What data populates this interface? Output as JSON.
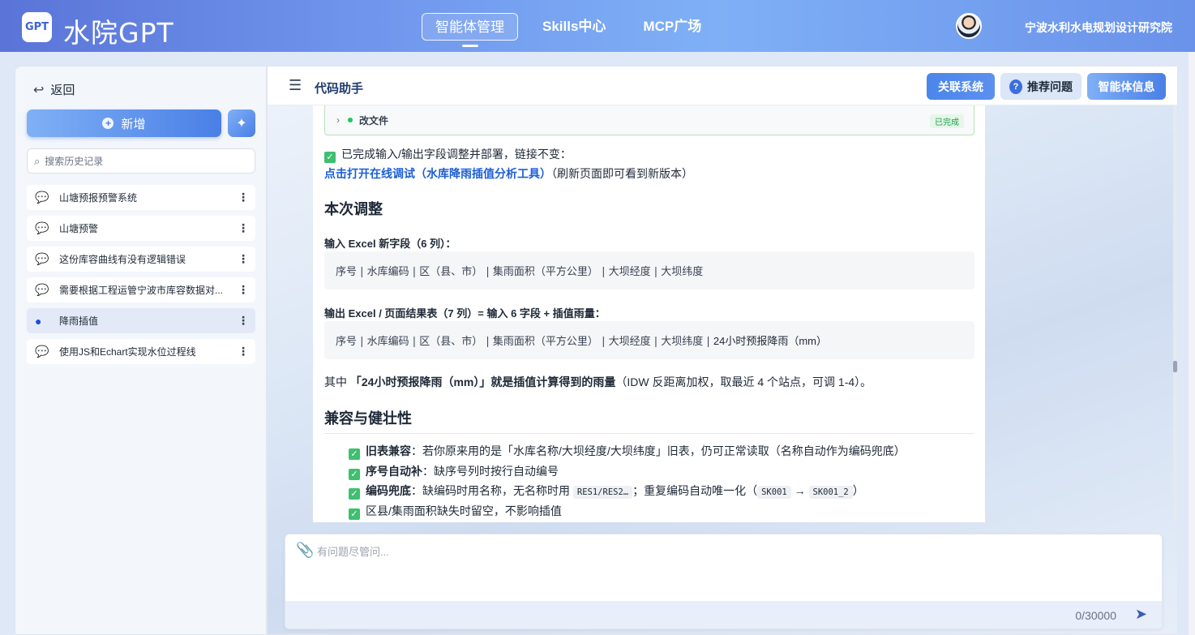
{
  "header": {
    "logo_text": "GPT",
    "app_title": "水院GPT",
    "nav": [
      "智能体管理",
      "Skills中心",
      "MCP广场"
    ],
    "org_name": "宁波水利水电规划设计研究院"
  },
  "sidebar": {
    "back_label": "返回",
    "new_label": "新增",
    "search_placeholder": "搜索历史记录",
    "history": [
      {
        "label": "山塘预报预警系统"
      },
      {
        "label": "山塘预警"
      },
      {
        "label": "这份库容曲线有没有逻辑错误"
      },
      {
        "label": "需要根据工程运管宁波市库容数据对..."
      },
      {
        "label": "降雨插值",
        "active": true
      },
      {
        "label": "使用JS和Echart实现水位过程线"
      }
    ]
  },
  "main": {
    "title": "代码助手",
    "buttons": {
      "link_system": "关联系统",
      "recommend": "推荐问题",
      "agent_info": "智能体信息"
    },
    "step": {
      "name": "改文件",
      "status": "已完成"
    },
    "done_line": "已完成输入/输出字段调整并部署，链接不变：",
    "link_text": "点击打开在线调试（水库降雨插值分析工具）",
    "link_note": "（刷新页面即可看到新版本）",
    "section1_title": "本次调整",
    "input_label": "输入 Excel 新字段（6 列）：",
    "input_fields": "序号 | 水库编码 | 区（县、市） | 集雨面积（平方公里） | 大坝经度 | 大坝纬度",
    "output_label": "输出 Excel / 页面结果表（7 列）= 输入 6 字段 + 插值雨量：",
    "output_fields_prefix": "序号 | 水库编码 | 区（县、市） | 集雨面积（平方公里） | 大坝经度 | 大坝纬度 | ",
    "output_fields_last": "24小时预报降雨（mm）",
    "note_prefix": "其中 ",
    "note_bold": "「24小时预报降雨（mm）」就是插值计算得到的雨量",
    "note_rest": "（IDW 反距离加权，取最近 4 个站点，可调 1-4）。",
    "section2_title": "兼容与健壮性",
    "bullets": {
      "b1_bold": "旧表兼容",
      "b1_text": "：若你原来用的是「水库名称/大坝经度/大坝纬度」旧表，仍可正常读取（名称自动作为编码兜底）",
      "b2_bold": "序号自动补",
      "b2_text": "：缺序号列时按行自动编号",
      "b3_bold": "编码兜底",
      "b3_text1": "：缺编码时用名称，无名称时用 ",
      "b3_chip1": "RES1/RES2…",
      "b3_text2": "；重复编码自动唯一化（",
      "b3_chip2": "SK001",
      "b3_arrow": " → ",
      "b3_chip3": "SK001_2",
      "b3_text3": "）",
      "b4_text": "区县/集雨面积缺失时留空，不影响插值"
    },
    "composer": {
      "placeholder": "有问题尽管问...",
      "counter": "0/30000"
    }
  }
}
